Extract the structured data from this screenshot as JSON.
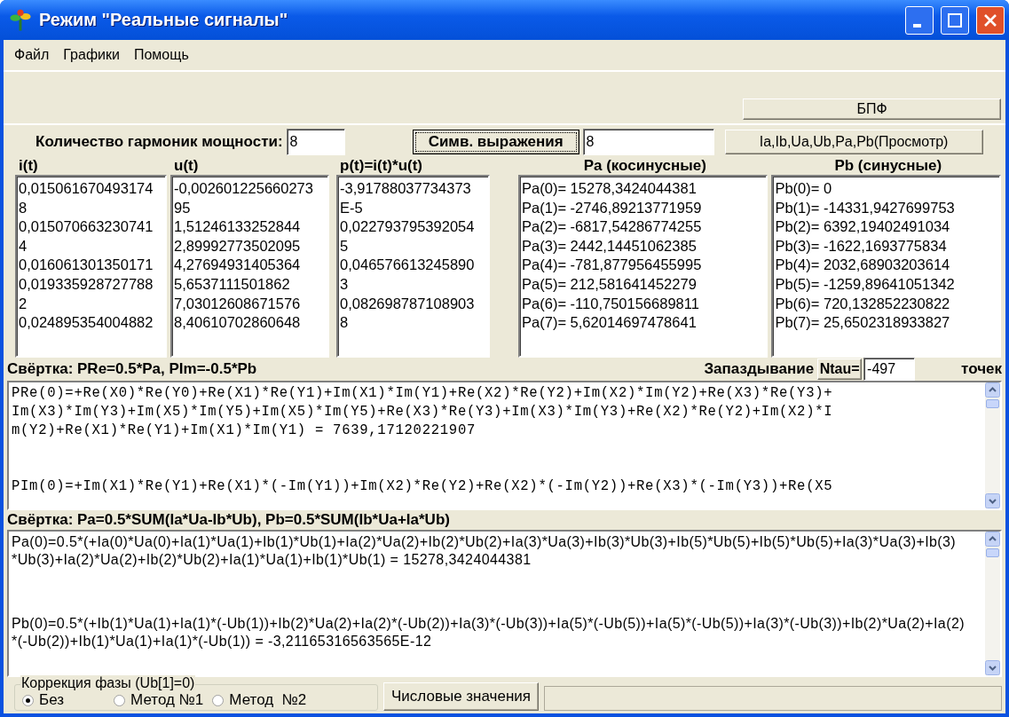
{
  "window": {
    "title": "Режим \"Реальные сигналы\""
  },
  "menu": [
    "Файл",
    "Графики",
    "Помощь"
  ],
  "fft_button": "БПФ",
  "harmonics": {
    "label": "Количество гармоник мощности:",
    "value": "8",
    "symbolic_button": "Симв. выражения",
    "symbolic_value": "8",
    "view_button": "Ia,Ib,Ua,Ub,Pa,Pb(Просмотр)"
  },
  "lists": [
    {
      "header": "i(t)",
      "lines": [
        "0,015061670493174",
        "8",
        "0,015070663230741",
        "4",
        "0,016061301350171",
        "0,019335928727788",
        "2",
        "0,024895354004882"
      ]
    },
    {
      "header": "u(t)",
      "lines": [
        "-0,002601225660273",
        "95",
        "1,51246133252844",
        "2,89992773502095",
        "4,27694931405364",
        "5,6537111501862",
        "7,03012608671576",
        "8,40610702860648"
      ]
    },
    {
      "header": "p(t)=i(t)*u(t)",
      "lines": [
        "-3,91788037734373",
        "E-5",
        "0,022793795392054",
        "5",
        "0,046576613245890",
        "3",
        "0,082698787108903",
        "8"
      ]
    },
    {
      "header": "Pa (косинусные)",
      "lines": [
        "Pa(0)= 15278,3424044381",
        "Pa(1)= -2746,89213771959",
        "Pa(2)= -6817,54286774255",
        "Pa(3)= 2442,14451062385",
        "Pa(4)= -781,877956455995",
        "Pa(5)= 212,581641452279",
        "Pa(6)= -110,750156689811",
        "Pa(7)= 5,62014697478641"
      ]
    },
    {
      "header": "Pb (синусные)",
      "lines": [
        "Pb(0)= 0",
        "Pb(1)= -14331,9427699753",
        "Pb(2)= 6392,19402491034",
        "Pb(3)= -1622,1693775834",
        "Pb(4)= 2032,68903203614",
        "Pb(5)= -1259,89641051342",
        "Pb(6)= 720,132852230822",
        "Pb(7)= 25,6502318933827"
      ]
    }
  ],
  "convolution_1": {
    "label": "Свёртка: PRe=0.5*Pa,  PIm=-0.5*Pb",
    "delay_label": "Запаздывание",
    "ntau_button": "Ntau=",
    "ntau_value": "-497",
    "points_label": "точек",
    "paragraphs": [
      [
        "PRe(0)=+Re(X0)*Re(Y0)+Re(X1)*Re(Y1)+Im(X1)*Im(Y1)+Re(X2)*Re(Y2)+Im(X2)*Im(Y2)+Re(X3)*Re(Y3)+",
        "Im(X3)*Im(Y3)+Im(X5)*Im(Y5)+Im(X5)*Im(Y5)+Re(X3)*Re(Y3)+Im(X3)*Im(Y3)+Re(X2)*Re(Y2)+Im(X2)*I",
        "m(Y2)+Re(X1)*Re(Y1)+Im(X1)*Im(Y1) = 7639,17120221907"
      ],
      [
        "PIm(0)=+Im(X1)*Re(Y1)+Re(X1)*(-Im(Y1))+Im(X2)*Re(Y2)+Re(X2)*(-Im(Y2))+Re(X3)*(-Im(Y3))+Re(X5"
      ]
    ]
  },
  "convolution_2": {
    "label": "Свёртка: Pa=0.5*SUM(Ia*Ua-Ib*Ub),  Pb=0.5*SUM(Ib*Ua+Ia*Ub)",
    "paragraphs": [
      [
        "Pa(0)=0.5*(+Ia(0)*Ua(0)+Ia(1)*Ua(1)+Ib(1)*Ub(1)+Ia(2)*Ua(2)+Ib(2)*Ub(2)+Ia(3)*Ua(3)+Ib(3)*Ub(3)+Ib(5)*Ub(5)+Ib(5)*Ub(5)+Ia(3)*Ua(3)+Ib(3)",
        "*Ub(3)+Ia(2)*Ua(2)+Ib(2)*Ub(2)+Ia(1)*Ua(1)+Ib(1)*Ub(1) = 15278,3424044381"
      ],
      [
        "Pb(0)=0.5*(+Ib(1)*Ua(1)+Ia(1)*(-Ub(1))+Ib(2)*Ua(2)+Ia(2)*(-Ub(2))+Ia(3)*(-Ub(3))+Ia(5)*(-Ub(5))+Ia(5)*(-Ub(5))+Ia(3)*(-Ub(3))+Ib(2)*Ua(2)+Ia(2)",
        "*(-Ub(2))+Ib(1)*Ua(1)+Ia(1)*(-Ub(1)) = -3,21165316563565E-12"
      ]
    ]
  },
  "phase_correction": {
    "label": "Коррекция фазы (Ub[1]=0)",
    "options": [
      {
        "label": "Без",
        "selected": true
      },
      {
        "label": "Метод №1",
        "selected": false
      },
      {
        "label": "Метод  №2",
        "selected": false
      }
    ]
  },
  "values_button": "Числовые значения"
}
